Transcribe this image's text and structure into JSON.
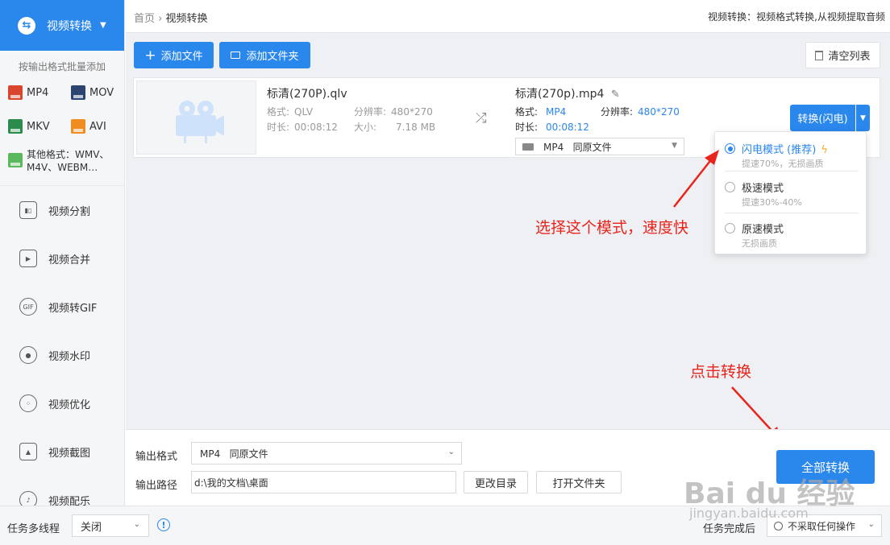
{
  "sidebar": {
    "header": "视频转换",
    "batch_hint": "按输出格式批量添加",
    "formats": [
      "MP4",
      "MOV",
      "MKV",
      "AVI"
    ],
    "other_formats": "其他格式：WMV、M4V、WEBM…",
    "tools": [
      "视频分割",
      "视频合并",
      "视频转GIF",
      "视频水印",
      "视频优化",
      "视频截图",
      "视频配乐"
    ]
  },
  "breadcrumb": {
    "home": "首页",
    "sep": "›",
    "current": "视频转换"
  },
  "header_desc": "视频转换：视频格式转换,从视频提取音频",
  "toolbar": {
    "add_file": "添加文件",
    "add_folder": "添加文件夹",
    "clear_list": "清空列表"
  },
  "file": {
    "source": {
      "name": "标清(270P).qlv",
      "format_label": "格式:",
      "format": "QLV",
      "resolution_label": "分辨率:",
      "resolution": "480*270",
      "duration_label": "时长:",
      "duration": "00:08:12",
      "size_label": "大小:",
      "size": "7.18 MB"
    },
    "target": {
      "name": "标清(270p).mp4",
      "format_label": "格式:",
      "format": "MP4",
      "resolution_label": "分辨率:",
      "resolution": "480*270",
      "duration_label": "时长:",
      "duration": "00:08:12",
      "format_select": "MP4   同原文件"
    },
    "convert_button": "转换(闪电)"
  },
  "mode_menu": [
    {
      "title": "闪电模式 (推荐)",
      "sub": "提速70%，无损画质",
      "selected": true
    },
    {
      "title": "极速模式",
      "sub": "提速30%-40%",
      "selected": false
    },
    {
      "title": "原速模式",
      "sub": "无损画质",
      "selected": false
    }
  ],
  "annotations": {
    "mode_hint": "选择这个模式，速度快",
    "convert_hint": "点击转换"
  },
  "output": {
    "format_label": "输出格式",
    "format_value": "MP4   同原文件",
    "path_label": "输出路径",
    "path_value": "d:\\我的文档\\桌面",
    "change_dir": "更改目录",
    "open_folder": "打开文件夹",
    "convert_all": "全部转换"
  },
  "statusbar": {
    "multithread_label": "任务多线程",
    "multithread_value": "关闭",
    "after_label": "任务完成后",
    "after_value": "不采取任何操作"
  },
  "watermark": {
    "main": "Bai du 经验",
    "sub": "jingyan.baidu.com"
  },
  "colors": {
    "accent": "#2a87ec",
    "annotation": "#e8241c"
  }
}
